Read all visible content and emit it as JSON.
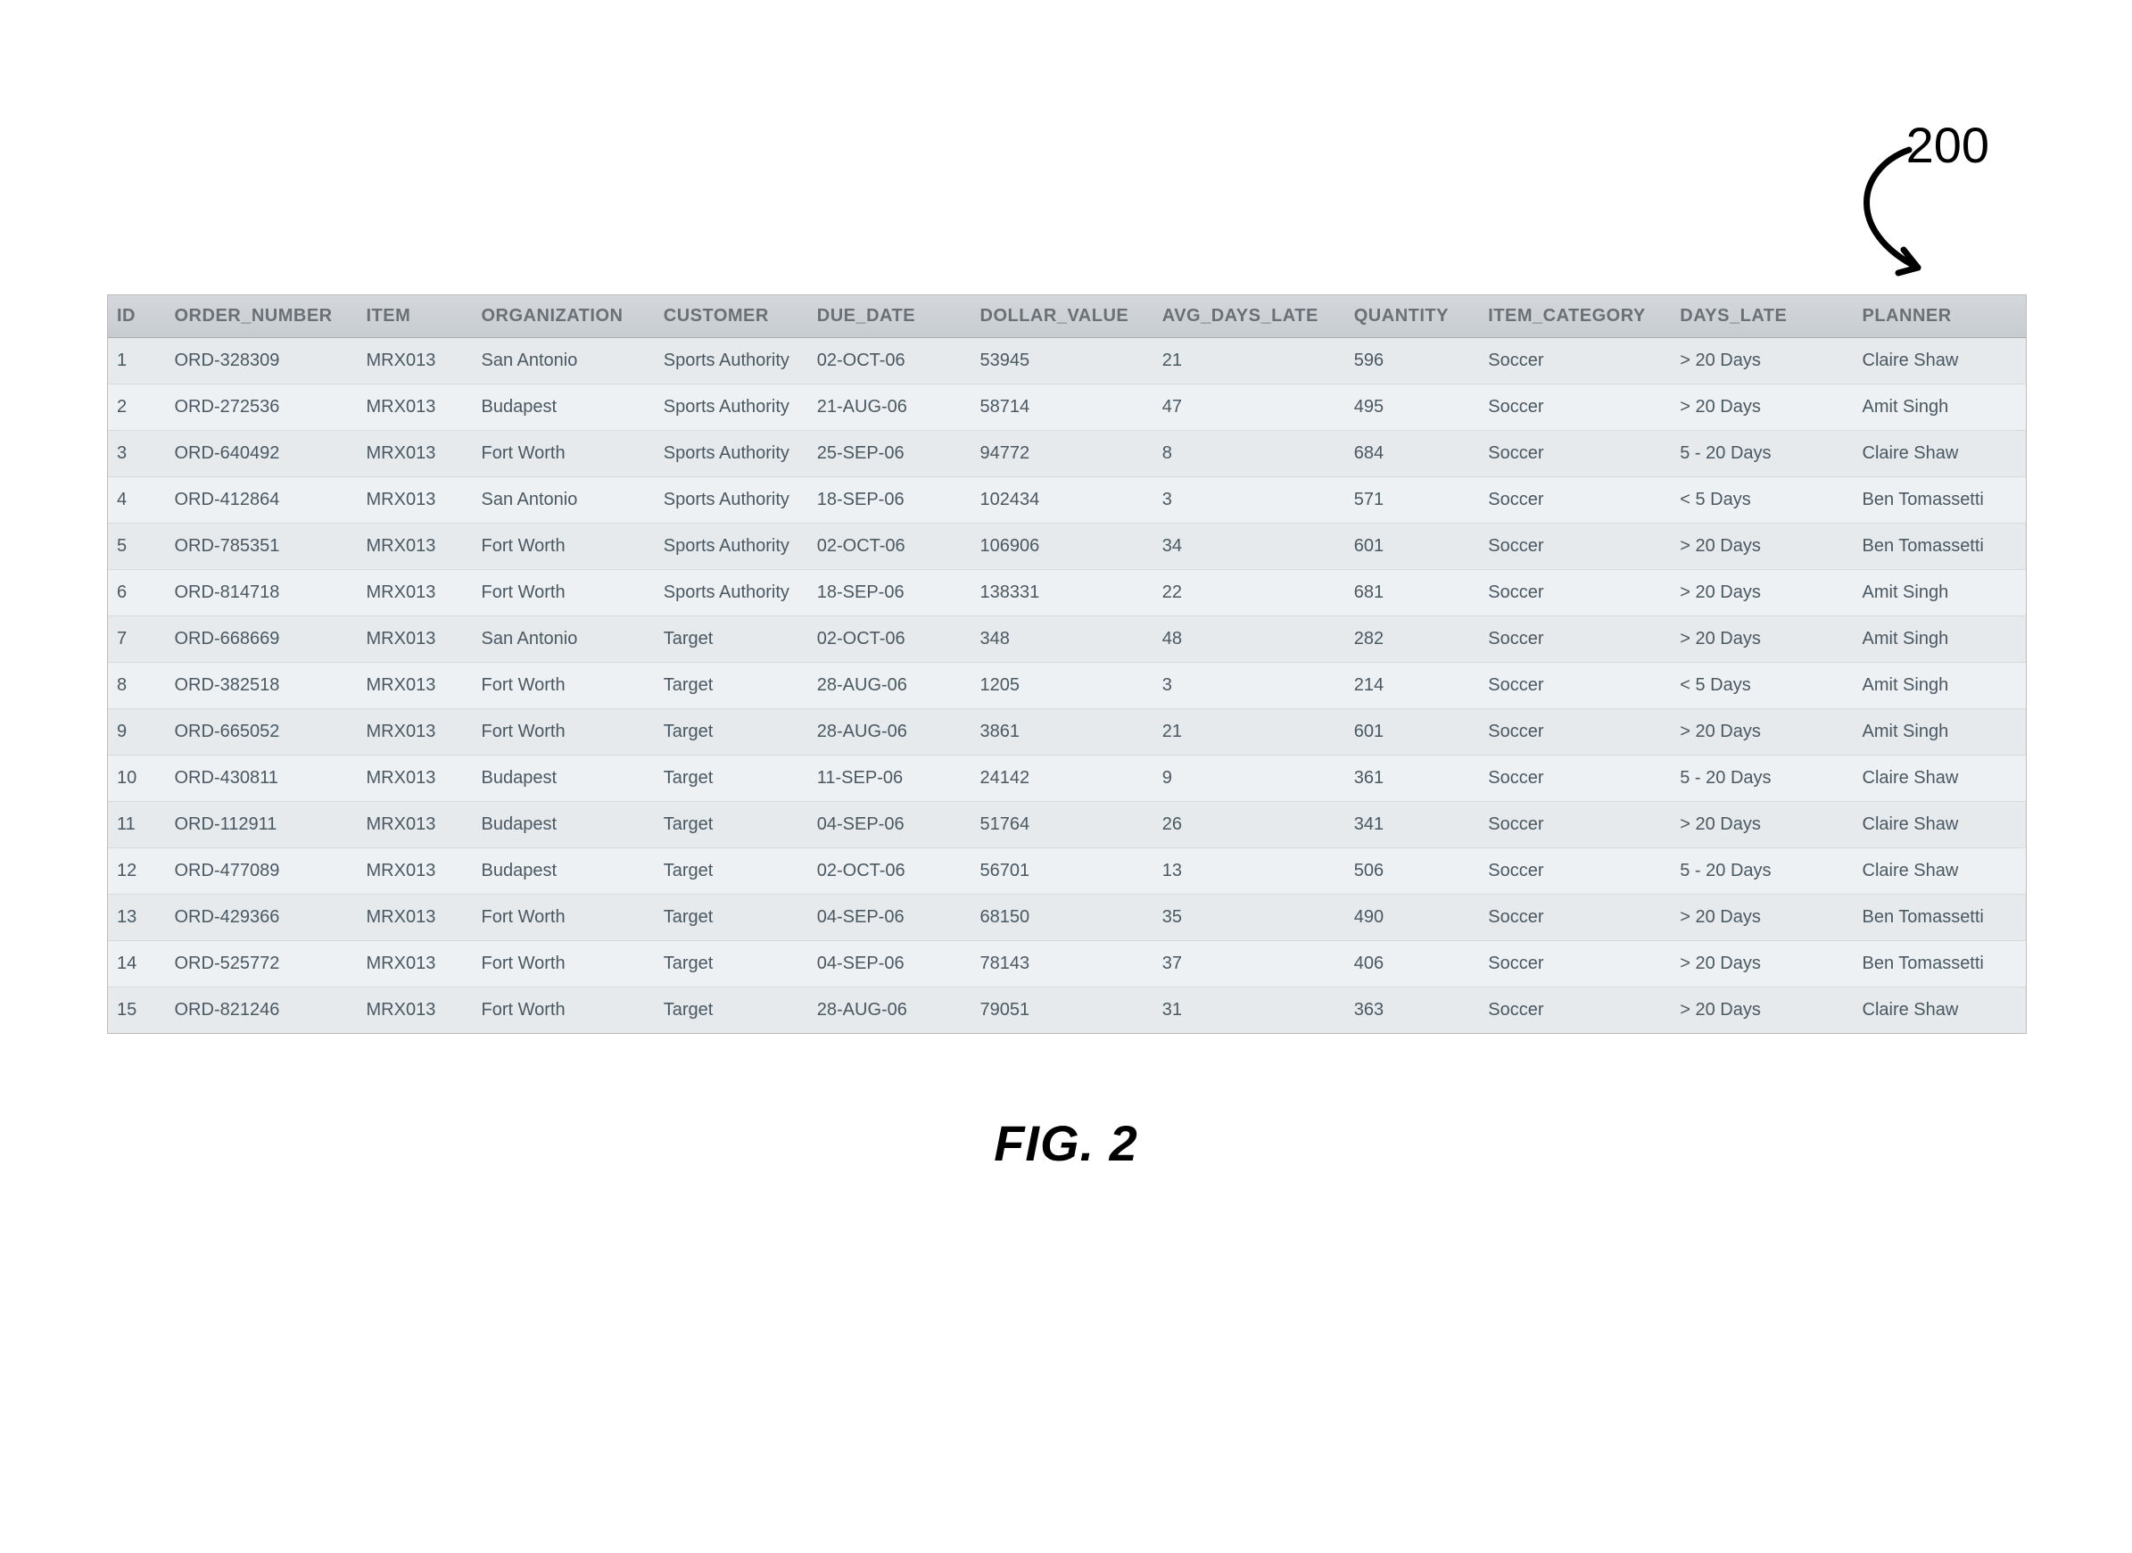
{
  "figure": {
    "reference_number": "200",
    "caption": "FIG. 2"
  },
  "table": {
    "columns": [
      "ID",
      "ORDER_NUMBER",
      "ITEM",
      "ORGANIZATION",
      "CUSTOMER",
      "DUE_DATE",
      "DOLLAR_VALUE",
      "AVG_DAYS_LATE",
      "QUANTITY",
      "ITEM_CATEGORY",
      "DAYS_LATE",
      "PLANNER"
    ],
    "rows": [
      {
        "id": "1",
        "order_number": "ORD-328309",
        "item": "MRX013",
        "organization": "San Antonio",
        "customer": "Sports Authority",
        "due_date": "02-OCT-06",
        "dollar_value": "53945",
        "avg_days_late": "21",
        "quantity": "596",
        "item_category": "Soccer",
        "days_late": "> 20 Days",
        "planner": "Claire Shaw"
      },
      {
        "id": "2",
        "order_number": "ORD-272536",
        "item": "MRX013",
        "organization": "Budapest",
        "customer": "Sports Authority",
        "due_date": "21-AUG-06",
        "dollar_value": "58714",
        "avg_days_late": "47",
        "quantity": "495",
        "item_category": "Soccer",
        "days_late": "> 20 Days",
        "planner": "Amit Singh"
      },
      {
        "id": "3",
        "order_number": "ORD-640492",
        "item": "MRX013",
        "organization": "Fort Worth",
        "customer": "Sports Authority",
        "due_date": "25-SEP-06",
        "dollar_value": "94772",
        "avg_days_late": "8",
        "quantity": "684",
        "item_category": "Soccer",
        "days_late": "5 - 20 Days",
        "planner": "Claire Shaw"
      },
      {
        "id": "4",
        "order_number": "ORD-412864",
        "item": "MRX013",
        "organization": "San Antonio",
        "customer": "Sports Authority",
        "due_date": "18-SEP-06",
        "dollar_value": "102434",
        "avg_days_late": "3",
        "quantity": "571",
        "item_category": "Soccer",
        "days_late": "< 5 Days",
        "planner": "Ben Tomassetti"
      },
      {
        "id": "5",
        "order_number": "ORD-785351",
        "item": "MRX013",
        "organization": "Fort Worth",
        "customer": "Sports Authority",
        "due_date": "02-OCT-06",
        "dollar_value": "106906",
        "avg_days_late": "34",
        "quantity": "601",
        "item_category": "Soccer",
        "days_late": "> 20 Days",
        "planner": "Ben Tomassetti"
      },
      {
        "id": "6",
        "order_number": "ORD-814718",
        "item": "MRX013",
        "organization": "Fort Worth",
        "customer": "Sports Authority",
        "due_date": "18-SEP-06",
        "dollar_value": "138331",
        "avg_days_late": "22",
        "quantity": "681",
        "item_category": "Soccer",
        "days_late": "> 20 Days",
        "planner": "Amit Singh"
      },
      {
        "id": "7",
        "order_number": "ORD-668669",
        "item": "MRX013",
        "organization": "San Antonio",
        "customer": "Target",
        "due_date": "02-OCT-06",
        "dollar_value": "348",
        "avg_days_late": "48",
        "quantity": "282",
        "item_category": "Soccer",
        "days_late": "> 20 Days",
        "planner": "Amit Singh"
      },
      {
        "id": "8",
        "order_number": "ORD-382518",
        "item": "MRX013",
        "organization": "Fort Worth",
        "customer": "Target",
        "due_date": "28-AUG-06",
        "dollar_value": "1205",
        "avg_days_late": "3",
        "quantity": "214",
        "item_category": "Soccer",
        "days_late": "< 5 Days",
        "planner": "Amit Singh"
      },
      {
        "id": "9",
        "order_number": "ORD-665052",
        "item": "MRX013",
        "organization": "Fort Worth",
        "customer": "Target",
        "due_date": "28-AUG-06",
        "dollar_value": "3861",
        "avg_days_late": "21",
        "quantity": "601",
        "item_category": "Soccer",
        "days_late": "> 20 Days",
        "planner": "Amit Singh"
      },
      {
        "id": "10",
        "order_number": "ORD-430811",
        "item": "MRX013",
        "organization": "Budapest",
        "customer": "Target",
        "due_date": "11-SEP-06",
        "dollar_value": "24142",
        "avg_days_late": "9",
        "quantity": "361",
        "item_category": "Soccer",
        "days_late": "5 - 20 Days",
        "planner": "Claire Shaw"
      },
      {
        "id": "11",
        "order_number": "ORD-112911",
        "item": "MRX013",
        "organization": "Budapest",
        "customer": "Target",
        "due_date": "04-SEP-06",
        "dollar_value": "51764",
        "avg_days_late": "26",
        "quantity": "341",
        "item_category": "Soccer",
        "days_late": "> 20 Days",
        "planner": "Claire Shaw"
      },
      {
        "id": "12",
        "order_number": "ORD-477089",
        "item": "MRX013",
        "organization": "Budapest",
        "customer": "Target",
        "due_date": "02-OCT-06",
        "dollar_value": "56701",
        "avg_days_late": "13",
        "quantity": "506",
        "item_category": "Soccer",
        "days_late": "5 - 20 Days",
        "planner": "Claire Shaw"
      },
      {
        "id": "13",
        "order_number": "ORD-429366",
        "item": "MRX013",
        "organization": "Fort Worth",
        "customer": "Target",
        "due_date": "04-SEP-06",
        "dollar_value": "68150",
        "avg_days_late": "35",
        "quantity": "490",
        "item_category": "Soccer",
        "days_late": "> 20 Days",
        "planner": "Ben Tomassetti"
      },
      {
        "id": "14",
        "order_number": "ORD-525772",
        "item": "MRX013",
        "organization": "Fort Worth",
        "customer": "Target",
        "due_date": "04-SEP-06",
        "dollar_value": "78143",
        "avg_days_late": "37",
        "quantity": "406",
        "item_category": "Soccer",
        "days_late": "> 20 Days",
        "planner": "Ben Tomassetti"
      },
      {
        "id": "15",
        "order_number": "ORD-821246",
        "item": "MRX013",
        "organization": "Fort Worth",
        "customer": "Target",
        "due_date": "28-AUG-06",
        "dollar_value": "79051",
        "avg_days_late": "31",
        "quantity": "363",
        "item_category": "Soccer",
        "days_late": "> 20 Days",
        "planner": "Claire Shaw"
      }
    ]
  }
}
